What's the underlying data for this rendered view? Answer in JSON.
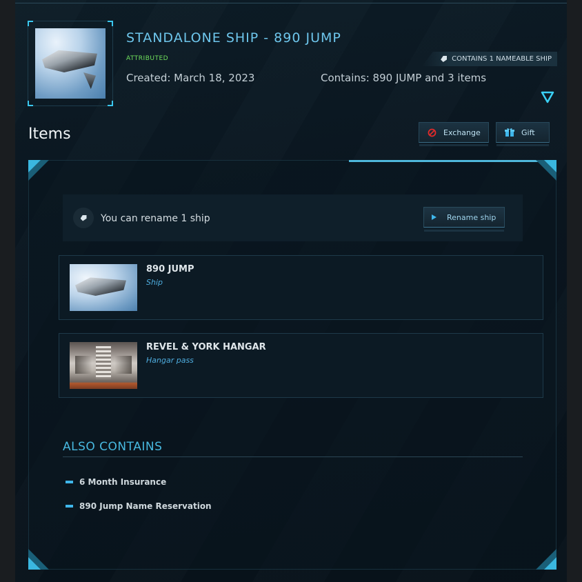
{
  "package": {
    "title": "STANDALONE SHIP - 890 JUMP",
    "status": "ATTRIBUTED",
    "nameable_badge": "CONTAINS 1 NAMEABLE SHIP",
    "created": "Created: March 18, 2023",
    "contains": "Contains: 890 JUMP and 3 items"
  },
  "items_section": {
    "heading": "Items",
    "exchange_label": "Exchange",
    "gift_label": "Gift"
  },
  "rename": {
    "text": "You can rename 1 ship",
    "button_label": "Rename ship"
  },
  "items": [
    {
      "name": "890 JUMP",
      "type": "Ship"
    },
    {
      "name": "REVEL & YORK HANGAR",
      "type": "Hangar pass"
    }
  ],
  "also_contains": {
    "heading": "ALSO CONTAINS",
    "items": [
      "6 Month Insurance",
      "890 Jump Name Reservation"
    ]
  },
  "colors": {
    "accent": "#48b9e0",
    "status_green": "#6fe05c",
    "exchange_icon": "#e02a2a",
    "gift_icon": "#3fb6ea"
  },
  "icons": {
    "tag": "tag-icon",
    "expand": "chevron-down-icon",
    "exchange": "prohibited-icon",
    "gift": "gift-icon",
    "rename": "play-icon"
  }
}
